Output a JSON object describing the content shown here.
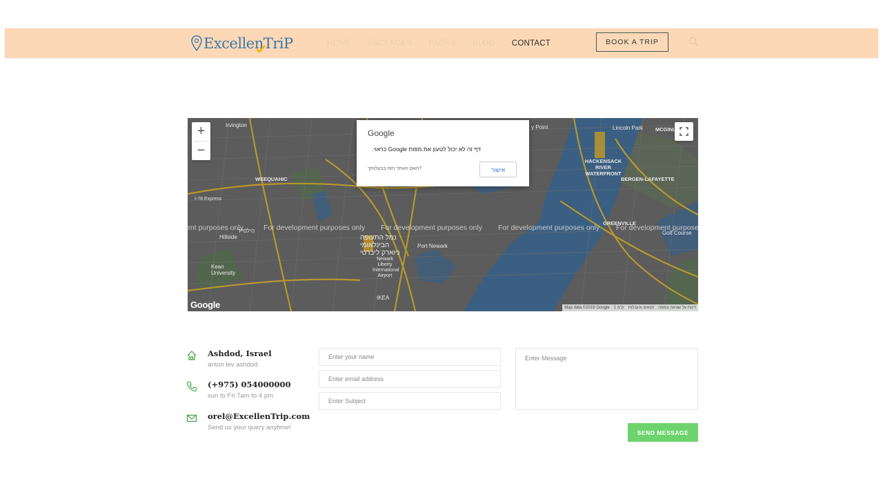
{
  "header": {
    "logo_text": "ExcellenTriP",
    "nav": [
      "HOME",
      "PACKAGES",
      "PAGES",
      "BLOG",
      "CONTACT"
    ],
    "active_nav": "CONTACT",
    "book_button": "BOOK A TRIP",
    "colors": {
      "background": "#fdd8b6",
      "logo": "#3a79a8",
      "check": "#f0b400"
    }
  },
  "map": {
    "dialog": {
      "brand": "Google",
      "message": "דף זה לא יכול לטעון את מפות Google כראוי.",
      "question": "האם האתר הזה בבעלותך?",
      "ok_button": "אישור"
    },
    "watermark": [
      "ent purposes only",
      "For development purposes only",
      "For development purposes only",
      "For development purposes only",
      "For development purposes"
    ],
    "place_labels": {
      "irvington": "Irvington",
      "weequahic": "WEEQUAHIC",
      "hillside": "Hillside",
      "kean": "Kean University",
      "port_newark": "Port Newark",
      "airport": "Newark Liberty International Airport",
      "airport_hebrew": "נמל התעופה הבינלאומי ניוארק ליברטי",
      "ikea": "IKEA",
      "lincoln_park": "Lincoln Park",
      "mcginley": "MCGINLE",
      "hackensack": "HACKENSACK RIVER WATERFRONT",
      "bergen": "BERGEN-LAFAYETTE",
      "greenville": "GREENVILLE",
      "golf": "Golf Course",
      "express": "I-78 Express",
      "point": "y Point",
      "hillside_he": "הילסייד"
    },
    "google_logo": "Google",
    "footer": [
      "Map data ©2019 Google",
      "1 ק\"מ",
      "תנאים והגבלות",
      "דיווח על שגיאה במפה"
    ]
  },
  "contact": {
    "address_title": "Ashdod, Israel",
    "address_sub": "anton lev ashdod",
    "phone_title": "(+975) 054000000",
    "phone_sub": "sun to Fri 7am to 4 pm",
    "email_title": "orel@ExcellenTrip.com",
    "email_sub": "Send us your query anytime!",
    "icon_color": "#3ea33e"
  },
  "form": {
    "name_placeholder": "Enter your name",
    "email_placeholder": "Enter email address",
    "subject_placeholder": "Enter Subject",
    "message_placeholder": "Enter Message",
    "send_button": "SEND MESSAGE"
  }
}
